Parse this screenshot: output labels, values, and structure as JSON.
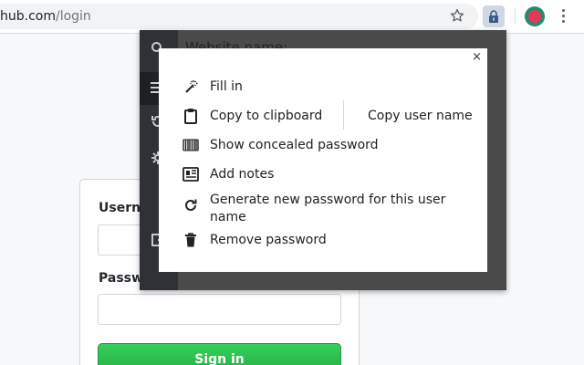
{
  "browser": {
    "url_host": "hub.com",
    "url_path": "/login",
    "icons": [
      "star-icon",
      "password-manager-extension-icon",
      "profile-avatar",
      "menu-icon"
    ]
  },
  "login": {
    "username_label": "Userna",
    "password_label": "Passwo",
    "sign_in_label": "Sign in"
  },
  "popup": {
    "header_text": "Website name:",
    "menu": {
      "fill_in": "Fill in",
      "copy_to_clipboard": "Copy to clipboard",
      "copy_user_name": "Copy user name",
      "show_password": "Show concealed password",
      "add_notes": "Add notes",
      "generate_password": "Generate new password for this user name",
      "remove_password": "Remove password",
      "close": "×"
    }
  },
  "colors": {
    "sign_in_green": "#2ea44f",
    "popup_frame": "#4a4a4a",
    "popup_sidebar": "#2f3136"
  }
}
